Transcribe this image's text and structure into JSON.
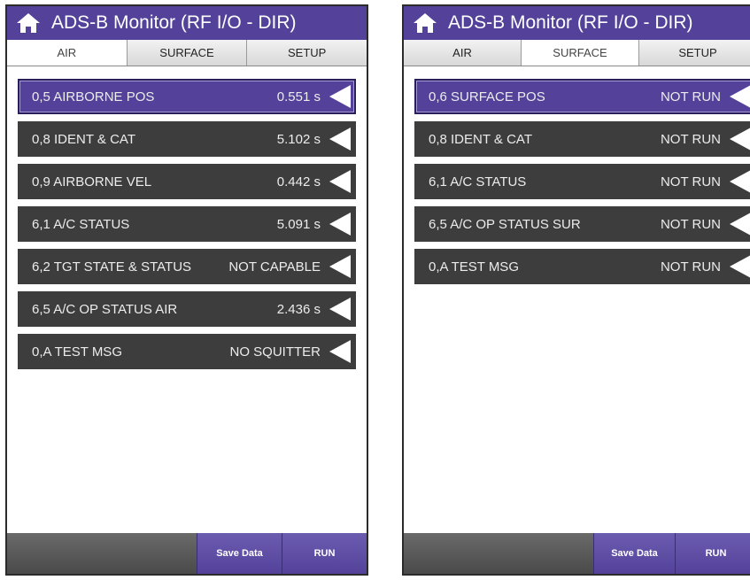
{
  "left": {
    "title": "ADS-B Monitor (RF I/O - DIR)",
    "tabs": [
      {
        "label": "AIR",
        "active": true
      },
      {
        "label": "SURFACE",
        "active": false
      },
      {
        "label": "SETUP",
        "active": false
      }
    ],
    "rows": [
      {
        "label": "0,5 AIRBORNE POS",
        "value": "0.551 s",
        "selected": true
      },
      {
        "label": "0,8 IDENT & CAT",
        "value": "5.102 s"
      },
      {
        "label": "0,9 AIRBORNE VEL",
        "value": "0.442 s"
      },
      {
        "label": "6,1 A/C STATUS",
        "value": "5.091 s"
      },
      {
        "label": "6,2 TGT STATE & STATUS",
        "value": "NOT CAPABLE"
      },
      {
        "label": "6,5 A/C OP STATUS AIR",
        "value": "2.436 s"
      },
      {
        "label": "0,A TEST MSG",
        "value": "NO SQUITTER"
      }
    ],
    "buttons": {
      "save": "Save Data",
      "run": "RUN"
    }
  },
  "right": {
    "title": "ADS-B Monitor (RF I/O - DIR)",
    "tabs": [
      {
        "label": "AIR",
        "active": false
      },
      {
        "label": "SURFACE",
        "active": true
      },
      {
        "label": "SETUP",
        "active": false
      }
    ],
    "rows": [
      {
        "label": "0,6 SURFACE POS",
        "value": "NOT RUN",
        "selected": true
      },
      {
        "label": "0,8 IDENT & CAT",
        "value": "NOT RUN"
      },
      {
        "label": "6,1 A/C STATUS",
        "value": "NOT RUN"
      },
      {
        "label": "6,5 A/C OP STATUS SUR",
        "value": "NOT RUN"
      },
      {
        "label": "0,A TEST MSG",
        "value": "NOT RUN"
      }
    ],
    "buttons": {
      "save": "Save Data",
      "run": "RUN"
    }
  },
  "colors": {
    "accent": "#54429a",
    "row_bg": "#3d3d3d",
    "row_text": "#ececec"
  },
  "icons": {
    "home": "home-icon",
    "expand": "triangle-left-icon"
  }
}
